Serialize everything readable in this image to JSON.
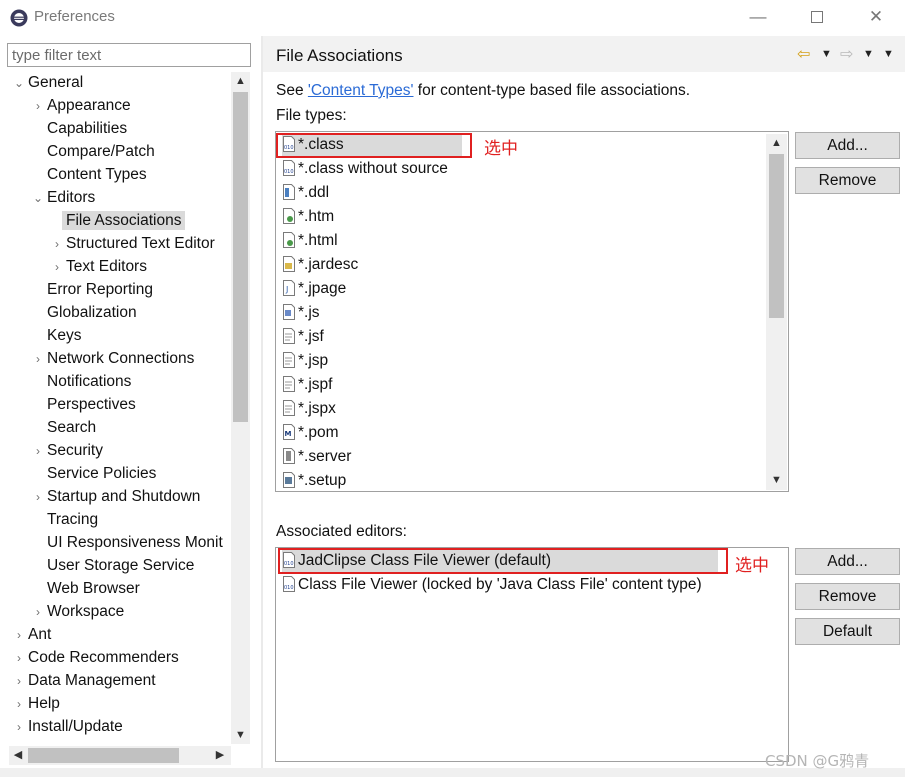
{
  "window": {
    "title": "Preferences",
    "minimize": "—",
    "close": "✕"
  },
  "filter": {
    "placeholder": "type filter text",
    "value": ""
  },
  "tree": [
    {
      "label": "General",
      "level": 0,
      "twisty": "expanded"
    },
    {
      "label": "Appearance",
      "level": 1,
      "twisty": "collapsed"
    },
    {
      "label": "Capabilities",
      "level": 1,
      "twisty": "none"
    },
    {
      "label": "Compare/Patch",
      "level": 1,
      "twisty": "none"
    },
    {
      "label": "Content Types",
      "level": 1,
      "twisty": "none"
    },
    {
      "label": "Editors",
      "level": 1,
      "twisty": "expanded"
    },
    {
      "label": "File Associations",
      "level": 2,
      "twisty": "none",
      "selected": true
    },
    {
      "label": "Structured Text Editor",
      "level": 2,
      "twisty": "collapsed"
    },
    {
      "label": "Text Editors",
      "level": 2,
      "twisty": "collapsed"
    },
    {
      "label": "Error Reporting",
      "level": 1,
      "twisty": "none"
    },
    {
      "label": "Globalization",
      "level": 1,
      "twisty": "none"
    },
    {
      "label": "Keys",
      "level": 1,
      "twisty": "none"
    },
    {
      "label": "Network Connections",
      "level": 1,
      "twisty": "collapsed"
    },
    {
      "label": "Notifications",
      "level": 1,
      "twisty": "none"
    },
    {
      "label": "Perspectives",
      "level": 1,
      "twisty": "none"
    },
    {
      "label": "Search",
      "level": 1,
      "twisty": "none"
    },
    {
      "label": "Security",
      "level": 1,
      "twisty": "collapsed"
    },
    {
      "label": "Service Policies",
      "level": 1,
      "twisty": "none"
    },
    {
      "label": "Startup and Shutdown",
      "level": 1,
      "twisty": "collapsed"
    },
    {
      "label": "Tracing",
      "level": 1,
      "twisty": "none"
    },
    {
      "label": "UI Responsiveness Monit",
      "level": 1,
      "twisty": "none"
    },
    {
      "label": "User Storage Service",
      "level": 1,
      "twisty": "none"
    },
    {
      "label": "Web Browser",
      "level": 1,
      "twisty": "none"
    },
    {
      "label": "Workspace",
      "level": 1,
      "twisty": "collapsed"
    },
    {
      "label": "Ant",
      "level": 0,
      "twisty": "collapsed"
    },
    {
      "label": "Code Recommenders",
      "level": 0,
      "twisty": "collapsed"
    },
    {
      "label": "Data Management",
      "level": 0,
      "twisty": "collapsed"
    },
    {
      "label": "Help",
      "level": 0,
      "twisty": "collapsed"
    },
    {
      "label": "Install/Update",
      "level": 0,
      "twisty": "collapsed"
    }
  ],
  "page": {
    "title": "File Associations",
    "see_prefix": "See ",
    "see_link": "'Content Types'",
    "see_suffix": " for content-type based file associations.",
    "file_types_label": "File types:",
    "associated_editors_label": "Associated editors:"
  },
  "file_types": [
    {
      "label": "*.class",
      "icon": "class-file-icon",
      "selected": true
    },
    {
      "label": "*.class without source",
      "icon": "class-file-icon"
    },
    {
      "label": "*.ddl",
      "icon": "ddl-file-icon"
    },
    {
      "label": "*.htm",
      "icon": "html-file-icon"
    },
    {
      "label": "*.html",
      "icon": "html-file-icon"
    },
    {
      "label": "*.jardesc",
      "icon": "jardesc-file-icon"
    },
    {
      "label": "*.jpage",
      "icon": "jpage-file-icon"
    },
    {
      "label": "*.js",
      "icon": "js-file-icon"
    },
    {
      "label": "*.jsf",
      "icon": "text-file-icon"
    },
    {
      "label": "*.jsp",
      "icon": "text-file-icon"
    },
    {
      "label": "*.jspf",
      "icon": "text-file-icon"
    },
    {
      "label": "*.jspx",
      "icon": "text-file-icon"
    },
    {
      "label": "*.pom",
      "icon": "maven-pom-icon"
    },
    {
      "label": "*.server",
      "icon": "server-file-icon"
    },
    {
      "label": "*.setup",
      "icon": "setup-file-icon"
    }
  ],
  "editors": [
    {
      "label": "JadClipse Class File Viewer (default)",
      "icon": "class-viewer-icon",
      "selected": true
    },
    {
      "label": "Class File Viewer (locked by 'Java Class File' content type)",
      "icon": "class-viewer-icon"
    }
  ],
  "buttons": {
    "types_add": "Add...",
    "types_remove": "Remove",
    "editors_add": "Add...",
    "editors_remove": "Remove",
    "editors_default": "Default"
  },
  "annotations": {
    "types_selected": "选中",
    "editors_selected": "选中"
  },
  "watermark": "CSDN @G鸦青",
  "colors": {
    "annotation_red": "#e02020",
    "link_blue": "#2b6bd6",
    "selection_gray": "#dadada"
  }
}
